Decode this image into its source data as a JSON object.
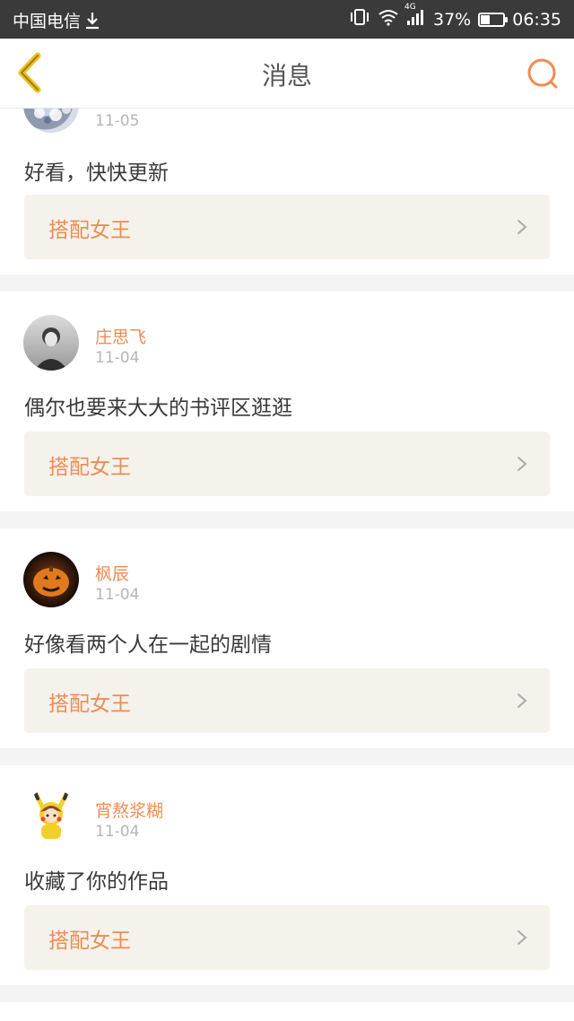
{
  "status_bar": {
    "carrier": "中国电信",
    "battery": "37%",
    "time": "06:35",
    "network": "4G",
    "icons": [
      "download-icon",
      "vibrate-icon",
      "wifi-icon",
      "signal-icon",
      "battery-icon"
    ]
  },
  "nav": {
    "title": "消息",
    "back_icon": "chevron-left-icon",
    "search_icon": "search-icon"
  },
  "accent_color": "#ef8c55",
  "messages": [
    {
      "user": "",
      "date": "11-05",
      "comment": "好看，快快更新",
      "work": "搭配女王"
    },
    {
      "user": "庄思飞",
      "date": "11-04",
      "comment": "偶尔也要来大大的书评区逛逛",
      "work": "搭配女王"
    },
    {
      "user": "枫辰",
      "date": "11-04",
      "comment": "好像看两个人在一起的剧情",
      "work": "搭配女王"
    },
    {
      "user": "宵熬浆糊",
      "date": "11-04",
      "comment": "收藏了你的作品",
      "work": "搭配女王"
    }
  ]
}
